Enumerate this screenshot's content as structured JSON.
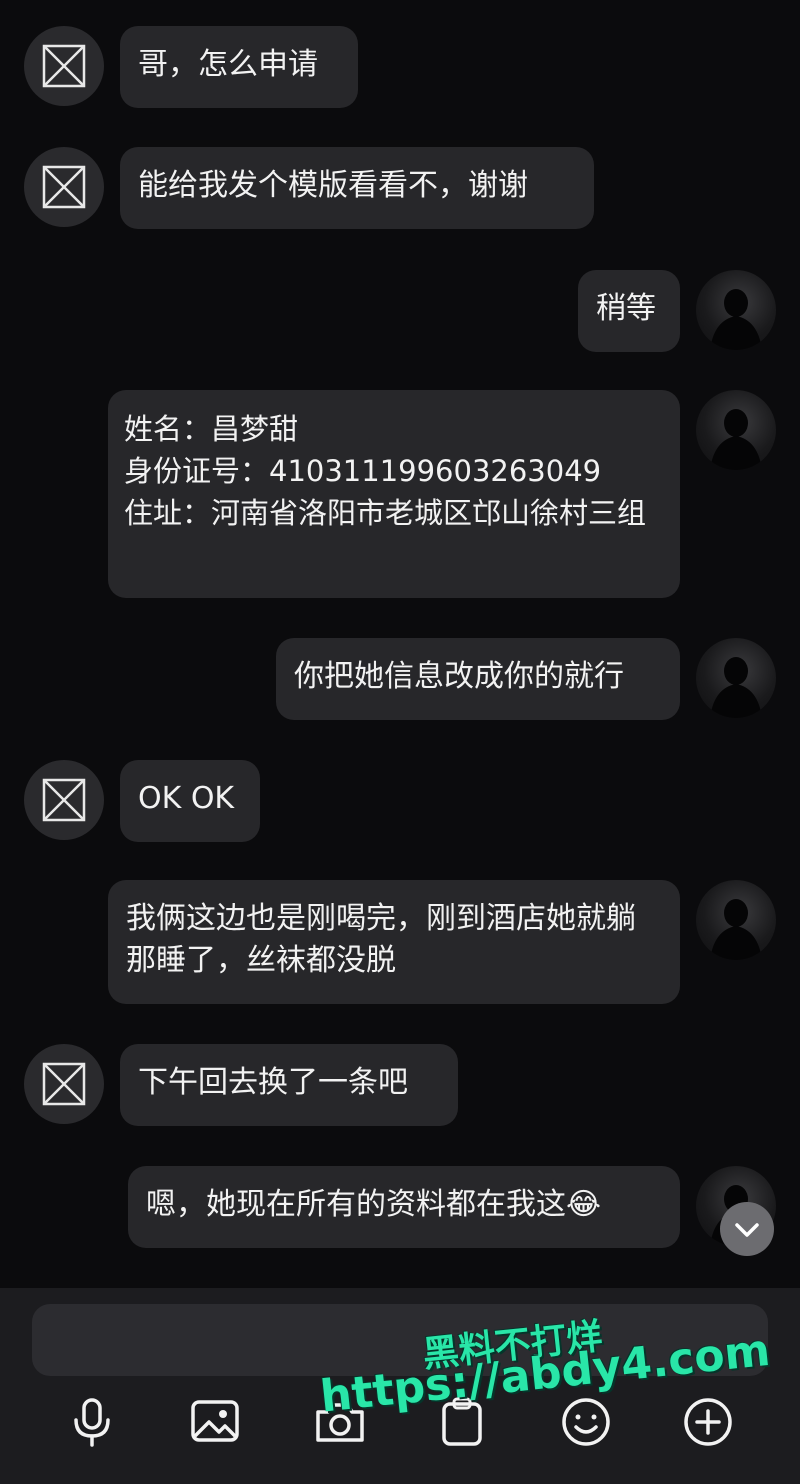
{
  "messages": [
    {
      "side": "peer",
      "text": "哥，怎么申请"
    },
    {
      "side": "peer",
      "text": "能给我发个模版看看不，谢谢"
    },
    {
      "side": "self",
      "text": "稍等"
    },
    {
      "side": "self",
      "text": "姓名：昌梦甜\n身份证号：410311199603263049\n住址：河南省洛阳市老城区邙山徐村三组"
    },
    {
      "side": "self",
      "text": "你把她信息改成你的就行"
    },
    {
      "side": "peer",
      "text": "OK OK"
    },
    {
      "side": "self",
      "text": "我俩这边也是刚喝完，刚到酒店她就躺那睡了，丝袜都没脱"
    },
    {
      "side": "peer",
      "text": "下午回去换了一条吧"
    },
    {
      "side": "self",
      "text": "嗯，她现在所有的资料都在我这😂"
    }
  ],
  "toolbar": {
    "icons": [
      "microphone-icon",
      "image-icon",
      "camera-icon",
      "clipboard-icon",
      "emoji-icon",
      "plus-icon"
    ]
  },
  "watermark": {
    "line1": "黑料不打烊",
    "line2": "https://abdy4.com"
  },
  "colors": {
    "background": "#0b0b0d",
    "bubble": "#27272a",
    "text": "#f2f2f2",
    "watermark": "#29e6a8"
  }
}
